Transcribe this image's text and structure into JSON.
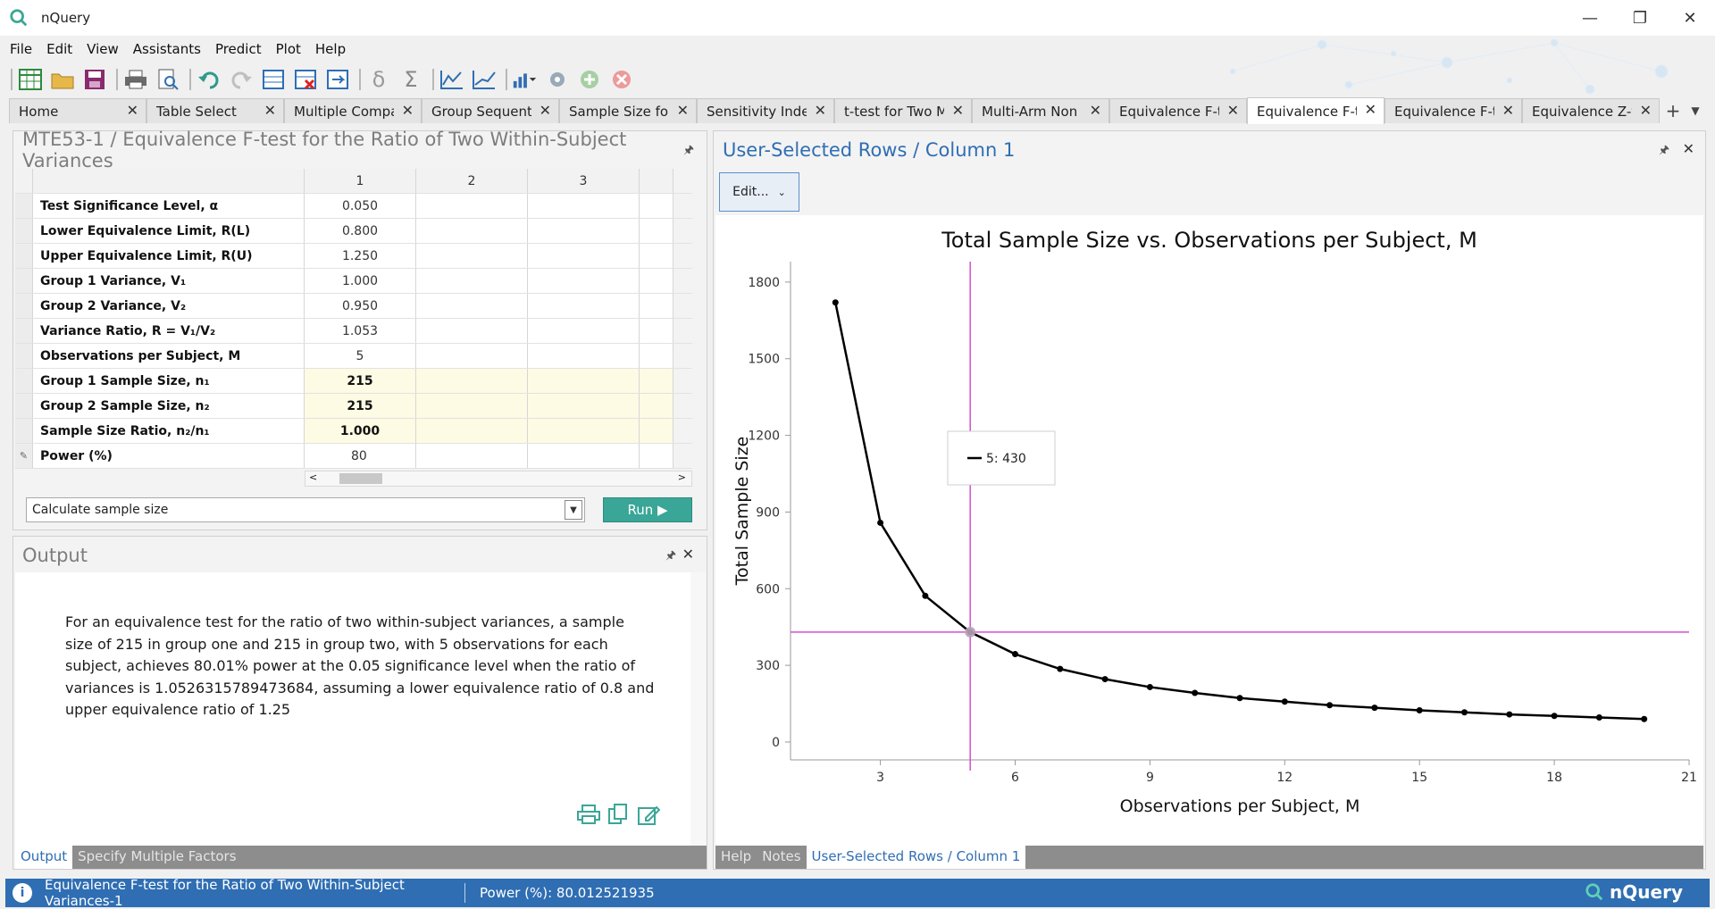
{
  "window": {
    "title": "nQuery",
    "minimize": "—",
    "restore": "❐",
    "close": "✕"
  },
  "menu": [
    "File",
    "Edit",
    "View",
    "Assistants",
    "Predict",
    "Plot",
    "Help"
  ],
  "toolbar_icons": [
    "new-table-icon",
    "open-folder-icon",
    "save-icon",
    "print-icon",
    "print-preview-icon",
    "undo-icon",
    "redo-icon",
    "insert-rows-icon",
    "delete-rows-icon",
    "fill-right-icon",
    "delta-icon",
    "sigma-icon",
    "line-plot-icon",
    "line-chart-icon",
    "plot-options-icon",
    "settings-icon",
    "add-icon",
    "cancel-icon"
  ],
  "tabs": [
    {
      "label": "Home"
    },
    {
      "label": "Table Select"
    },
    {
      "label": "Multiple Compa"
    },
    {
      "label": "Group Sequenti"
    },
    {
      "label": "Sample Size for"
    },
    {
      "label": "Sensitivity Inde"
    },
    {
      "label": "t-test for Two M"
    },
    {
      "label": "Multi-Arm Non"
    },
    {
      "label": "Equivalence F-t"
    },
    {
      "label": "Equivalence F-t"
    },
    {
      "label": "Equivalence F-t"
    },
    {
      "label": "Equivalence Z-t"
    }
  ],
  "active_tab": 9,
  "tab_plus": "+",
  "tab_dropdown": "▼",
  "tab_close": "✕",
  "left_panel": {
    "title": "MTE53-1 / Equivalence F-test for the Ratio of Two Within-Subject Variances",
    "pin": "📌",
    "columns": [
      "1",
      "2",
      "3"
    ],
    "rows": [
      {
        "label": "Test Significance Level, α",
        "value": "0.050",
        "out": false
      },
      {
        "label": "Lower Equivalence Limit, R(L)",
        "value": "0.800",
        "out": false
      },
      {
        "label": "Upper Equivalence Limit, R(U)",
        "value": "1.250",
        "out": false
      },
      {
        "label": "Group 1 Variance, V₁",
        "value": "1.000",
        "out": false
      },
      {
        "label": "Group 2 Variance, V₂",
        "value": "0.950",
        "out": false
      },
      {
        "label": "Variance Ratio, R = V₁/V₂",
        "value": "1.053",
        "out": false
      },
      {
        "label": "Observations per Subject, M",
        "value": "5",
        "out": false
      },
      {
        "label": "Group 1 Sample Size, n₁",
        "value": "215",
        "out": true
      },
      {
        "label": "Group 2 Sample Size, n₂",
        "value": "215",
        "out": true
      },
      {
        "label": "Sample Size Ratio, n₂/n₁",
        "value": "1.000",
        "out": true
      },
      {
        "label": "Power (%)",
        "value": "80",
        "out": false,
        "edit": true
      }
    ],
    "calc_select": "Calculate sample size",
    "run_label": "Run ▶"
  },
  "output_panel": {
    "title": "Output",
    "text": "For an equivalence test for the ratio of two within-subject variances, a sample size of 215 in group one and 215 in group two, with 5 observations for each subject, achieves 80.01% power at the 0.05 significance level when the ratio of variances is 1.0526315789473684, assuming a lower equivalence ratio of 0.8 and upper equivalence ratio of 1.25",
    "tabs": [
      "Output",
      "Specify Multiple Factors"
    ]
  },
  "right_panel": {
    "title": "User-Selected Rows / Column 1",
    "edit_label": "Edit...",
    "tabs": [
      "Help",
      "Notes",
      "User-Selected Rows / Column 1"
    ]
  },
  "chart_data": {
    "type": "line",
    "title": "Total Sample Size vs. Observations per Subject, M",
    "xlabel": "Observations per Subject, M",
    "ylabel": "Total Sample Size",
    "xlim": [
      1,
      21
    ],
    "ylim": [
      -70,
      1880
    ],
    "xticks": [
      3,
      6,
      9,
      12,
      15,
      18,
      21
    ],
    "yticks": [
      0,
      300,
      600,
      900,
      1200,
      1500,
      1800
    ],
    "x": [
      2,
      3,
      4,
      5,
      6,
      7,
      8,
      9,
      10,
      11,
      12,
      13,
      14,
      15,
      16,
      17,
      18,
      19,
      20
    ],
    "series": [
      {
        "values": [
          1720,
          858,
          572,
          430,
          344,
          286,
          246,
          215,
          192,
          172,
          158,
          144,
          134,
          124,
          116,
          108,
          102,
          96,
          90
        ]
      }
    ],
    "selected": {
      "x": 5,
      "y": 430
    },
    "legend": "5: 430",
    "crosshair_color": "#d24fd1",
    "line_color": "#000000"
  },
  "status": {
    "left": "Equivalence F-test for the Ratio of Two Within-Subject Variances-1",
    "right": "Power (%): 80.012521935",
    "brand": "nQuery"
  }
}
